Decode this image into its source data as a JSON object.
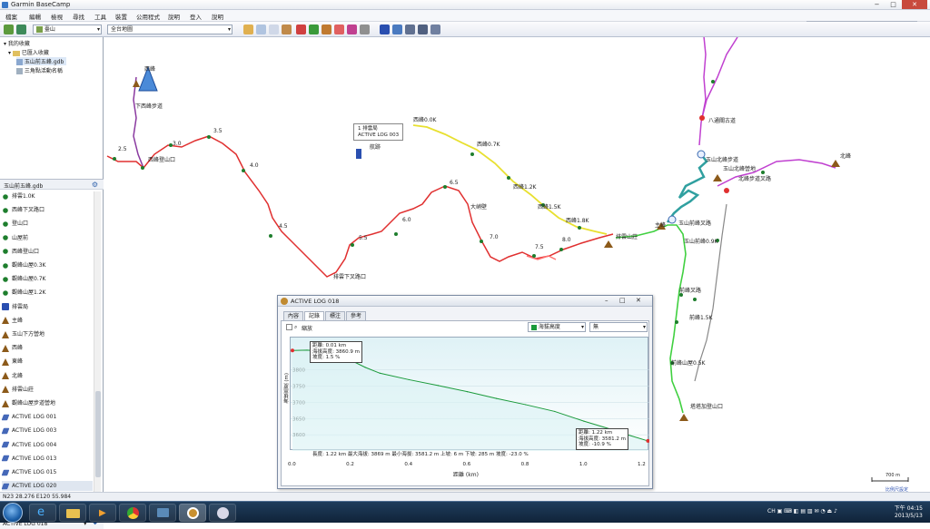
{
  "app": {
    "title": "Garmin BaseCamp"
  },
  "window": {
    "min": "−",
    "max": "□",
    "close": "✕"
  },
  "menu": [
    "檔案",
    "編輯",
    "檢視",
    "尋找",
    "工具",
    "裝置",
    "公用程式",
    "說明",
    "登入",
    "說明"
  ],
  "search": {
    "placeholder": "搜尋",
    "icon": "search-icon"
  },
  "toolbar": {
    "combo1": "臺山",
    "combo2": "全台地圖"
  },
  "tree": {
    "root": "我的收藏",
    "item1": "已匯入收藏",
    "item2": "玉山前五峰.gdb",
    "item3": "三角點活動名稱"
  },
  "list": {
    "header": "玉山前五峰.gdb",
    "items": [
      {
        "icon": "dot",
        "label": "排雲1.0K"
      },
      {
        "icon": "dot",
        "label": "西峰下叉路口"
      },
      {
        "icon": "dot",
        "label": "登山口"
      },
      {
        "icon": "dot",
        "label": "山屋前"
      },
      {
        "icon": "dot",
        "label": "西峰登山口"
      },
      {
        "icon": "dot",
        "label": "觀峰山屋0.3K"
      },
      {
        "icon": "dot",
        "label": "觀峰山屋0.7K"
      },
      {
        "icon": "dot",
        "label": "觀峰山屋1.2K"
      },
      {
        "icon": "wp",
        "label": "排雲局"
      },
      {
        "icon": "tri",
        "label": "主峰"
      },
      {
        "icon": "tri",
        "label": "玉山下方營地"
      },
      {
        "icon": "tri",
        "label": "西峰"
      },
      {
        "icon": "tri",
        "label": "東峰"
      },
      {
        "icon": "tri",
        "label": "北峰"
      },
      {
        "icon": "tri",
        "label": "排雲山莊"
      },
      {
        "icon": "tri",
        "label": "觀峰山屋步道營地"
      },
      {
        "icon": "trk",
        "label": "ACTIVE LOG 001"
      },
      {
        "icon": "trk",
        "label": "ACTIVE LOG 003"
      },
      {
        "icon": "trk",
        "label": "ACTIVE LOG 004"
      },
      {
        "icon": "trk",
        "label": "ACTIVE LOG 013"
      },
      {
        "icon": "trk",
        "label": "ACTIVE LOG 015"
      },
      {
        "icon": "trk",
        "label": "ACTIVE LOG 020"
      },
      {
        "icon": "trk",
        "label": "ACTIVE LOG 024"
      }
    ],
    "footer": "ACTIVE LOG 018"
  },
  "status": {
    "coords": "N23 28.276 E120 55.984"
  },
  "map": {
    "labels": [
      {
        "t": "西峰",
        "cls": "peak"
      },
      {
        "t": "下西峰步道",
        "cls": "lbl"
      },
      {
        "t": "2.5",
        "cls": "km"
      },
      {
        "t": "3.0",
        "cls": "km"
      },
      {
        "t": "3.5",
        "cls": "km"
      },
      {
        "t": "4.0",
        "cls": "km"
      },
      {
        "t": "4.5",
        "cls": "km"
      },
      {
        "t": "5.5",
        "cls": "km"
      },
      {
        "t": "6.0",
        "cls": "km"
      },
      {
        "t": "6.5",
        "cls": "km"
      },
      {
        "t": "7.0",
        "cls": "km"
      },
      {
        "t": "7.5",
        "cls": "km"
      },
      {
        "t": "8.0",
        "cls": "km"
      },
      {
        "t": "西峰登山口",
        "cls": "lbl"
      },
      {
        "t": "排雲下叉路口",
        "cls": "lbl"
      },
      {
        "t": "大峭壁",
        "cls": "lbl"
      },
      {
        "t": "排雲山莊",
        "cls": "lbl"
      },
      {
        "t": "西峰0.0K",
        "cls": "lbl"
      },
      {
        "t": "西峰0.7K",
        "cls": "lbl"
      },
      {
        "t": "西峰1.2K",
        "cls": "lbl"
      },
      {
        "t": "西峰1.5K",
        "cls": "lbl"
      },
      {
        "t": "西峰1.8K",
        "cls": "lbl"
      },
      {
        "t": "八通關古道",
        "cls": "lbl"
      },
      {
        "t": "玉山北峰步道",
        "cls": "lbl"
      },
      {
        "t": "玉山北峰營地",
        "cls": "lbl"
      },
      {
        "t": "北峰",
        "cls": "lbl"
      },
      {
        "t": "主峰",
        "cls": "lbl"
      },
      {
        "t": "玉山前峰叉路",
        "cls": "lbl"
      },
      {
        "t": "玉山前峰0.9K",
        "cls": "lbl"
      },
      {
        "t": "前峰叉路",
        "cls": "lbl"
      },
      {
        "t": "前峰1.5K",
        "cls": "lbl"
      },
      {
        "t": "前峰山屋0.5K",
        "cls": "lbl"
      },
      {
        "t": "塔塔加登山口",
        "cls": "lbl"
      },
      {
        "t": "北峰步道叉路",
        "cls": "lbl"
      }
    ],
    "popup": {
      "l1": "1 排雲局",
      "l2": "ACTIVE LOG 003",
      "l3": "航跡"
    },
    "scale": "700 m",
    "scale_link": "比例尺設定"
  },
  "dialog": {
    "title": "ACTIVE LOG 018",
    "tabs": [
      "內容",
      "記錄",
      "標注",
      "參考"
    ],
    "zoom_label": "縮放",
    "series_select": "海拔高度",
    "unit_select": "無",
    "ylabel": "海拔高度 (m)",
    "xlabel": "距離 (km)",
    "stats": "長度: 1.22 km    最大海拔: 3869 m    最小海拔: 3581.2 m    上坡: 6 m    下坡: 285 m    坡度: -23.0 %",
    "tip1": {
      "l1": "距離: 0.01 km",
      "l2": "海拔高度: 3860.9 m",
      "l3": "坡度: 1.5 %"
    },
    "tip2": {
      "l1": "距離: 1.22 km",
      "l2": "海拔高度: 3581.2 m",
      "l3": "坡度: -10.9 %"
    }
  },
  "chart_data": {
    "type": "area",
    "title": "",
    "xlabel": "距離 (km)",
    "ylabel": "海拔高度 (m)",
    "xlim": [
      0,
      1.2
    ],
    "ylim": [
      3550,
      3900
    ],
    "xticks": [
      "0.0",
      "0.2",
      "0.4",
      "0.6",
      "0.8",
      "1.0",
      "1.2"
    ],
    "yticks": [
      "3600",
      "3650",
      "3700",
      "3750",
      "3800"
    ],
    "series": [
      {
        "values": [
          {
            "x": 0.0,
            "y": 3860
          },
          {
            "x": 0.05,
            "y": 3861
          },
          {
            "x": 0.1,
            "y": 3858
          },
          {
            "x": 0.2,
            "y": 3830
          },
          {
            "x": 0.25,
            "y": 3808
          },
          {
            "x": 0.3,
            "y": 3790
          },
          {
            "x": 0.4,
            "y": 3770
          },
          {
            "x": 0.5,
            "y": 3752
          },
          {
            "x": 0.6,
            "y": 3733
          },
          {
            "x": 0.7,
            "y": 3712
          },
          {
            "x": 0.8,
            "y": 3693
          },
          {
            "x": 0.9,
            "y": 3672
          },
          {
            "x": 1.0,
            "y": 3642
          },
          {
            "x": 1.1,
            "y": 3615
          },
          {
            "x": 1.15,
            "y": 3600
          },
          {
            "x": 1.22,
            "y": 3581
          }
        ]
      }
    ],
    "colors": {
      "line": "#1a9a3a",
      "fill": "#d9f1f4"
    }
  },
  "clock": {
    "time": "下午 04:15",
    "date": "2013/5/13"
  },
  "colors": {
    "red": "#e03030",
    "yellow": "#e8e030",
    "green": "#40d040",
    "magenta": "#c040d0",
    "grey": "#888888",
    "cyan": "#30b0b0"
  }
}
